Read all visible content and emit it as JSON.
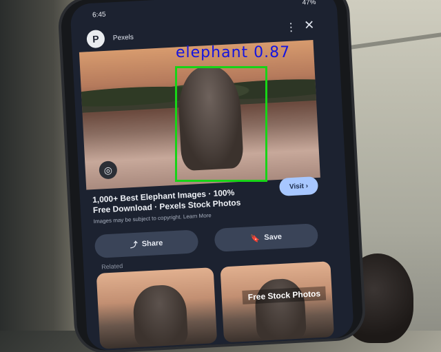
{
  "detection": {
    "label": "elephant 0.87",
    "box_color": "#17d417",
    "label_color": "#1414e0"
  },
  "phone": {
    "status": {
      "time": "6:45",
      "right": "47%"
    },
    "app": {
      "site_name": "Pexels",
      "logo_letter": "P"
    },
    "icons": {
      "kebab": "⋮",
      "close": "✕",
      "lens": "◎",
      "share": "share-icon",
      "bookmark": "bookmark-icon"
    },
    "result": {
      "caption": "1,000+ Best Elephant Images · 100% Free Download · Pexels Stock Photos",
      "disclaimer": "Images may be subject to copyright. Learn More",
      "visit_label": "Visit ›",
      "share_label": "Share",
      "save_label": "Save",
      "related_label": "Related"
    },
    "thumbnails": [
      {
        "label": ""
      },
      {
        "label": "Free Stock Photos"
      }
    ]
  }
}
